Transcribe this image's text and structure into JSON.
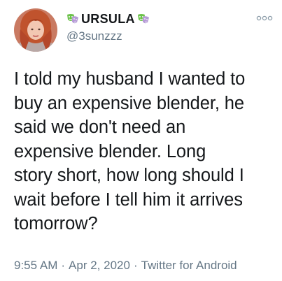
{
  "user": {
    "display_name": "URSULA",
    "handle": "@3sunzzz",
    "name_emoji_left": "performing-arts-mask-icon",
    "name_emoji_right": "performing-arts-mask-icon"
  },
  "tweet": {
    "text": "I told my husband I wanted to\nbuy an expensive blender, he\nsaid we don't need an\nexpensive blender. Long\nstory short, how long should I\nwait before I tell him it arrives\ntomorrow?",
    "time": "9:55 AM",
    "date": "Apr 2, 2020",
    "source": "Twitter for Android",
    "separator": "·"
  },
  "colors": {
    "text": "#14171a",
    "secondary": "#657786",
    "emoji_green": "#6cc24a",
    "emoji_purple": "#b59ad6"
  }
}
